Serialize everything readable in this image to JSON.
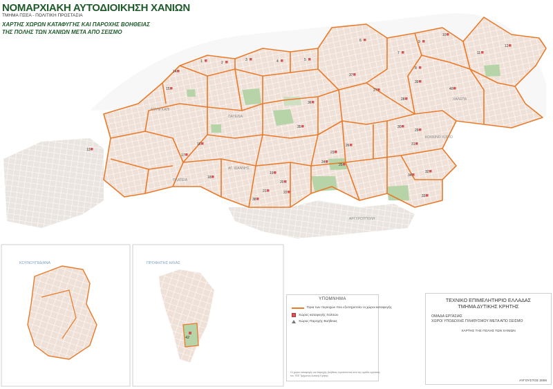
{
  "header": {
    "title": "ΝΟΜΑΡΧΙΑΚΗ ΑΥΤΟΔΙΟΙΚΗΣΗ ΧΑΝΙΩΝ",
    "subtitle": "ΤΜΗΜΑ ΠΣΕΑ - ΠΟΛΙΤΙΚΗ ΠΡΟΣΤΑΣΙΑ",
    "map_title_line1": "ΧΑΡΤΗΣ ΧΩΡΩΝ ΚΑΤΑΦΥΓΗΣ ΚΑΙ ΠΑΡΟΧΗΣ ΒΟΗΘΕΙΑΣ",
    "map_title_line2": "ΤΗΣ ΠΟΛΗΣ ΤΩΝ ΧΑΝΙΩΝ ΜΕΤΑ ΑΠΟ ΣΕΙΣΜΟ"
  },
  "insets": {
    "left_label": "ΚΟΥΝΟΥΠΙΔΙΑΝΑ",
    "right_label": "ΠΡΟΦΗΤΗΣ ΗΛΙΑΣ",
    "right_zone": "42"
  },
  "legend": {
    "title": "ΥΠΟΜΝΗΜΑ",
    "items": [
      {
        "label": "Όρια των περιοχών που εξυπηρετούν οι χώροι καταφυγής",
        "symbol": "orange-line"
      },
      {
        "label": "Χώρος καταφυγής πολιτών",
        "symbol": "red-square"
      },
      {
        "label": "Χώρος Παροχής Βοήθειας",
        "symbol": "triangle"
      }
    ],
    "footnote_line1": "Οι χώροι καταφυγής και παροχής βοήθειας προτείνονται από την ομάδα εργασίας",
    "footnote_line2": "του ΤΕΕ Τμήματος Δυτικής Κρήτης"
  },
  "info": {
    "org_line1": "ΤΕΧΝΙΚΟ ΕΠΙΜΕΛΗΤΗΡΙΟ ΕΛΛΑΔΑΣ",
    "org_line2": "ΤΜΗΜΑ ΔΥΤΙΚΗΣ ΚΡΗΤΗΣ",
    "working_group_line1": "ΟΜΑΔΑ ΕΡΓΑΣΙΑΣ",
    "working_group_line2": "ΧΩΡΟΙ ΥΠΟΔΟΧΗΣ ΠΛΗΘΥΣΜΟΥ ΜΕΤΑ ΑΠΟ ΣΕΙΣΜΟ",
    "map_name": "ΧΑΡΤΗΣ ΤΗΣ ΠΟΛΗΣ ΤΩΝ ΧΑΝΙΩΝ",
    "date": "ΑΥΓΟΥΣΤΟΣ 2006"
  },
  "districts": [
    "ΚΟΥΜ ΚΑΠΙ",
    "ΧΑΛΕΠΑ",
    "ΑΓ. ΙΩΑΝΝΗΣ",
    "ΚΟΚΚΙΝΟ ΧΩΡΙΟ",
    "ΑΡΓΥΡΟΥΠΟΛΗ",
    "ΚΟΥΝΟΥΠΙΔΙΑΝΑ"
  ],
  "zones": [
    "1",
    "2",
    "3",
    "4",
    "5",
    "6",
    "7",
    "8",
    "9",
    "10",
    "11",
    "12",
    "13",
    "14",
    "15",
    "16",
    "17",
    "18",
    "19",
    "20",
    "21",
    "22",
    "23",
    "24",
    "25",
    "26",
    "27",
    "28",
    "29",
    "30",
    "31",
    "32",
    "33",
    "34",
    "35",
    "36",
    "37",
    "38",
    "39",
    "40"
  ],
  "colors": {
    "land": "#efe1d8",
    "boundary": "#e87a2a",
    "park": "#b7d4a8",
    "title": "#1f5a2a",
    "shelter_marker": "#d45858",
    "sea": "#ffffff"
  }
}
